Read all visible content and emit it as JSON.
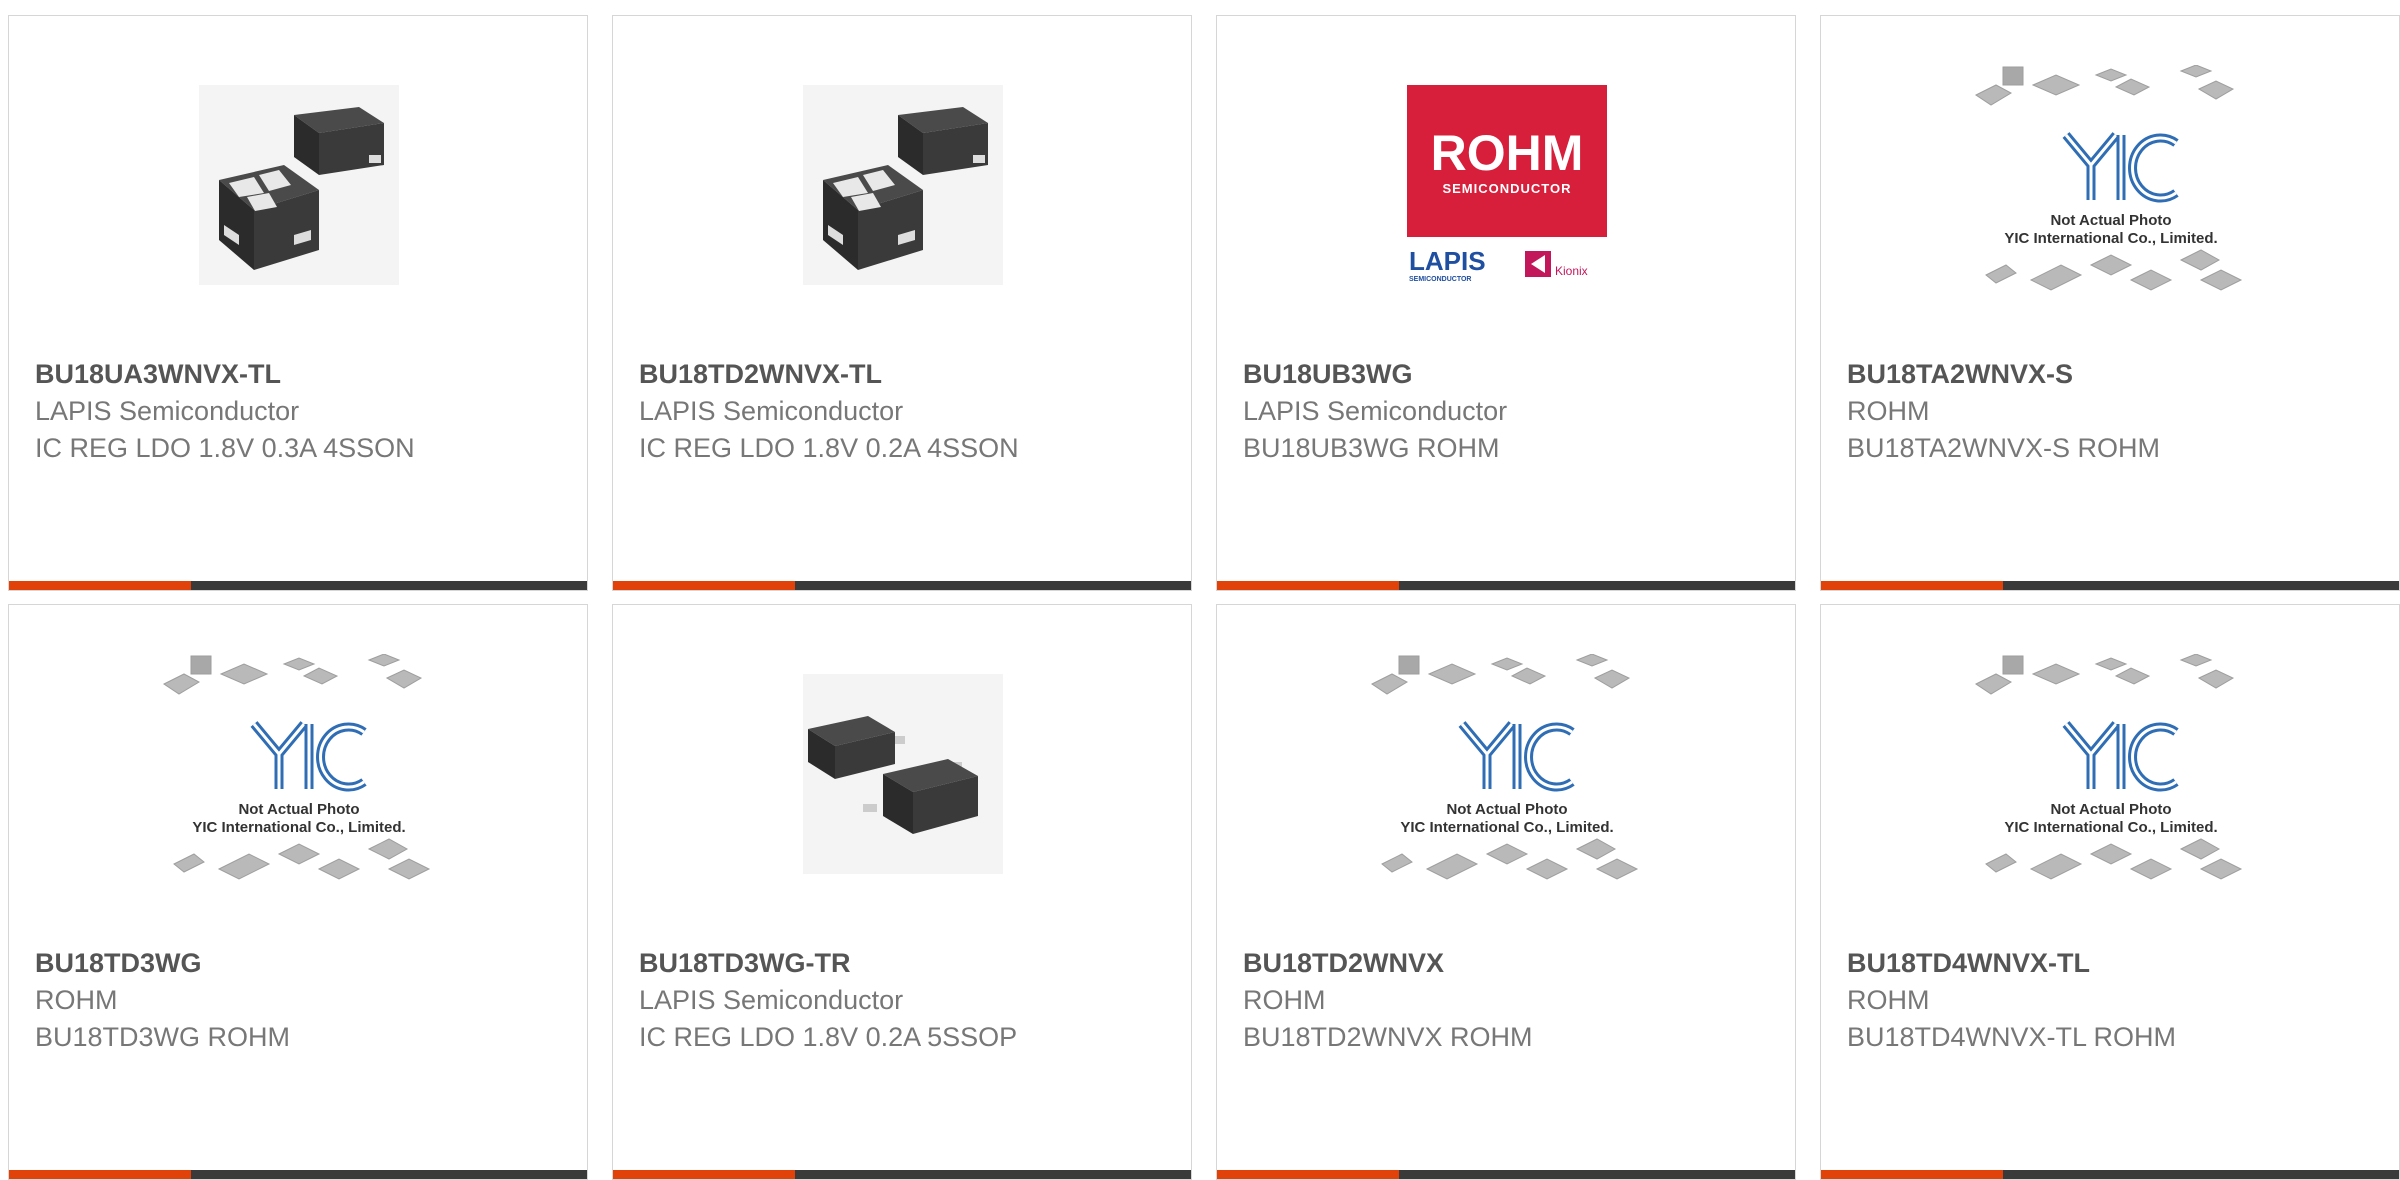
{
  "colors": {
    "accent": "#e0420a",
    "bar": "#3a3a3a",
    "border": "#d6d6d6"
  },
  "products": [
    {
      "part_number": "BU18UA3WNVX-TL",
      "manufacturer": "LAPIS Semiconductor",
      "description": "IC REG LDO 1.8V 0.3A 4SSON",
      "image_icon": "chip-sson-image"
    },
    {
      "part_number": "BU18TD2WNVX-TL",
      "manufacturer": "LAPIS Semiconductor",
      "description": "IC REG LDO 1.8V 0.2A 4SSON",
      "image_icon": "chip-sson-image"
    },
    {
      "part_number": "BU18UB3WG",
      "manufacturer": "LAPIS Semiconductor",
      "description": "BU18UB3WG ROHM",
      "image_icon": "rohm-logo-image"
    },
    {
      "part_number": "BU18TA2WNVX-S",
      "manufacturer": "ROHM",
      "description": "BU18TA2WNVX-S ROHM",
      "image_icon": "placeholder-image"
    },
    {
      "part_number": "BU18TD3WG",
      "manufacturer": "ROHM",
      "description": "BU18TD3WG ROHM",
      "image_icon": "placeholder-image"
    },
    {
      "part_number": "BU18TD3WG-TR",
      "manufacturer": "LAPIS Semiconductor",
      "description": "IC REG LDO 1.8V 0.2A 5SSOP",
      "image_icon": "chip-ssop-image"
    },
    {
      "part_number": "BU18TD2WNVX",
      "manufacturer": "ROHM",
      "description": "BU18TD2WNVX ROHM",
      "image_icon": "placeholder-image"
    },
    {
      "part_number": "BU18TD4WNVX-TL",
      "manufacturer": "ROHM",
      "description": "BU18TD4WNVX-TL ROHM",
      "image_icon": "placeholder-image"
    }
  ],
  "logo": {
    "brand": "ROHM",
    "brand_sub": "SEMICONDUCTOR",
    "partner1": "LAPIS",
    "partner1_sub": "SEMICONDUCTOR",
    "partner2": "Kionix"
  },
  "placeholder": {
    "brand": "YIC",
    "line1": "Not Actual Photo",
    "line2": "YIC International Co., Limited."
  }
}
